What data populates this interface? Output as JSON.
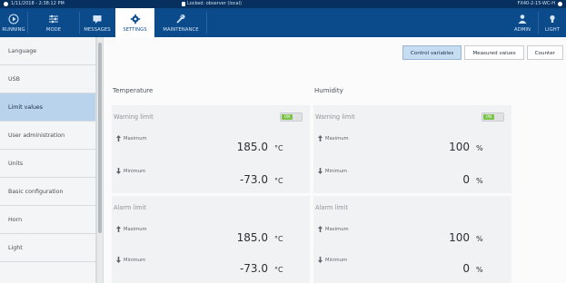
{
  "status": {
    "datetime": "1/11/2018 - 2:38:12 PM",
    "access": "Locked: observer (local)",
    "device": "FX40-2-15-WC-H"
  },
  "toolbar": {
    "items": [
      {
        "label": "RUNNING",
        "icon": "play-circle-icon"
      },
      {
        "label": "MODE",
        "icon": "mode-sliders-icon"
      },
      {
        "label": "MESSAGES",
        "icon": "message-icon"
      },
      {
        "label": "SETTINGS",
        "icon": "gear-icon"
      },
      {
        "label": "MAINTENANCE",
        "icon": "wrench-icon"
      }
    ],
    "user_label": "ADMIN",
    "light_label": "LIGHT"
  },
  "sidebar": {
    "items": [
      {
        "label": "Language"
      },
      {
        "label": "USB"
      },
      {
        "label": "Limit values"
      },
      {
        "label": "User administration"
      },
      {
        "label": "Units"
      },
      {
        "label": "Basic configuration"
      },
      {
        "label": "Horn"
      },
      {
        "label": "Light"
      }
    ],
    "active_index": 2
  },
  "tabs": [
    {
      "label": "Control variables"
    },
    {
      "label": "Measured values"
    },
    {
      "label": "Counter"
    }
  ],
  "active_tab": 0,
  "temperature": {
    "title": "Temperature",
    "warning": {
      "title": "Warning limit",
      "toggle": "ON",
      "max_label": "Maximum",
      "max_value": "185.0",
      "max_unit": "°C",
      "min_label": "Minimum",
      "min_value": "-73.0",
      "min_unit": "°C"
    },
    "alarm": {
      "title": "Alarm limit",
      "max_label": "Maximum",
      "max_value": "185.0",
      "max_unit": "°C",
      "min_label": "Minimum",
      "min_value": "-73.0",
      "min_unit": "°C"
    }
  },
  "humidity": {
    "title": "Humidity",
    "warning": {
      "title": "Warning limit",
      "toggle": "ON",
      "max_label": "Maximum",
      "max_value": "100",
      "max_unit": "%",
      "min_label": "Minimum",
      "min_value": "0",
      "min_unit": "%"
    },
    "alarm": {
      "title": "Alarm limit",
      "max_label": "Maximum",
      "max_value": "100",
      "max_unit": "%",
      "min_label": "Minimum",
      "min_value": "0",
      "min_unit": "%"
    }
  },
  "colors": {
    "statusbar": "#07305f",
    "toolbar": "#0b4b8c",
    "sidebar_active": "#b9d3ed",
    "tab_active": "#c6dcf1",
    "toggle_on": "#7cc24a"
  }
}
